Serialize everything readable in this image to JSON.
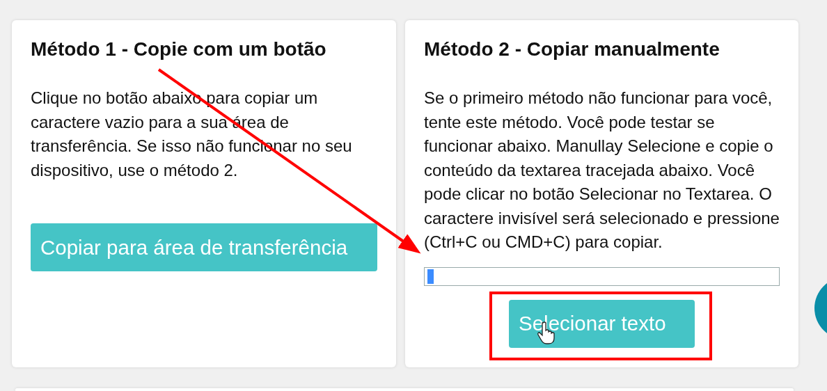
{
  "cards": [
    {
      "kind": "button",
      "title": "Método 1 - Copie com um botão",
      "text": "Clique no botão abaixo para copiar um caractere vazio para a sua área de transferência. Se isso não funcionar no seu dispositivo, use o método 2.",
      "button": "Copiar para área de transferência"
    },
    {
      "kind": "textarea",
      "title": "Método 2 - Copiar manualmente",
      "text": "Se o primeiro método não funcionar para você, tente este método. Você pode testar se funcionar abaixo. Manullay Selecione e copie o conteúdo da textarea tracejada abaixo. Você pode clicar no botão Selecionar no Textarea. O caractere invisível será selecionado e pressione (Ctrl+C ou CMD+C) para copiar.",
      "text_selected": true,
      "button": "Selecionar texto"
    }
  ]
}
